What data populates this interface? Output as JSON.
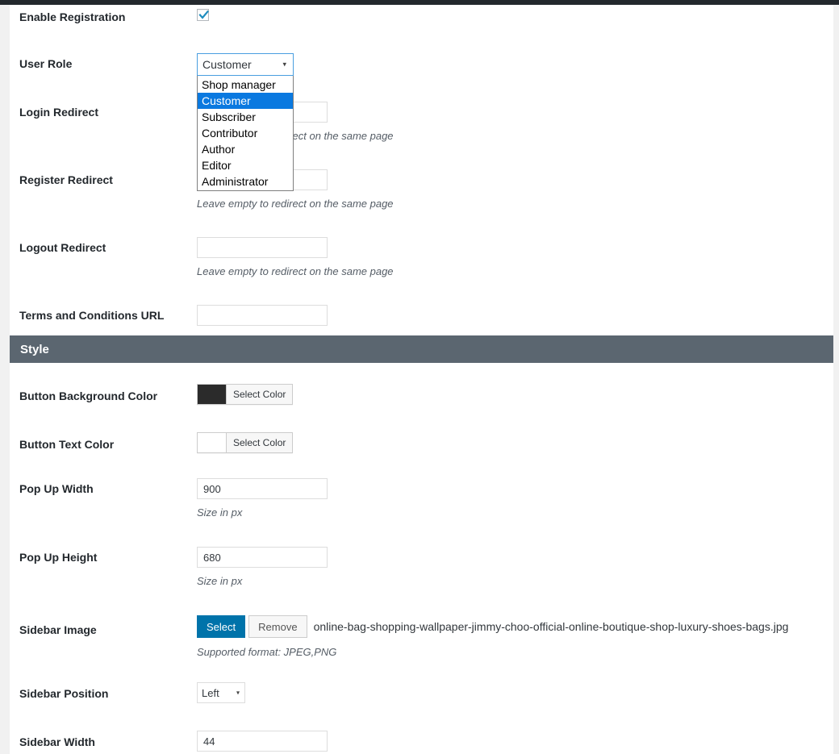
{
  "colors": {
    "adminbar": "#23282d",
    "section_header_bg": "#5b6670",
    "primary_button": "#0073aa",
    "select_highlight": "#0a79e0",
    "button_background_swatch": "#2b2b2b",
    "button_text_swatch": "#ffffff"
  },
  "fields": {
    "enable_registration": {
      "label": "Enable Registration",
      "checked": true
    },
    "user_role": {
      "label": "User Role",
      "value": "Customer",
      "expanded": true,
      "options": [
        "Shop manager",
        "Customer",
        "Subscriber",
        "Contributor",
        "Author",
        "Editor",
        "Administrator"
      ],
      "selected_index": 1
    },
    "login_redirect": {
      "label": "Login Redirect",
      "value": "",
      "hint": "Leave empty to redirect on the same page"
    },
    "register_redirect": {
      "label": "Register Redirect",
      "value": "",
      "hint": "Leave empty to redirect on the same page"
    },
    "logout_redirect": {
      "label": "Logout Redirect",
      "value": "",
      "hint": "Leave empty to redirect on the same page"
    },
    "terms_url": {
      "label": "Terms and Conditions URL",
      "value": ""
    },
    "button_background_color": {
      "label": "Button Background Color",
      "button_label": "Select Color",
      "swatch": "#2b2b2b"
    },
    "button_text_color": {
      "label": "Button Text Color",
      "button_label": "Select Color",
      "swatch": "#ffffff"
    },
    "popup_width": {
      "label": "Pop Up Width",
      "value": "900",
      "hint": "Size in px"
    },
    "popup_height": {
      "label": "Pop Up Height",
      "value": "680",
      "hint": "Size in px"
    },
    "sidebar_image": {
      "label": "Sidebar Image",
      "select_label": "Select",
      "remove_label": "Remove",
      "filename": "online-bag-shopping-wallpaper-jimmy-choo-official-online-boutique-shop-luxury-shoes-bags.jpg",
      "hint": "Supported format: JPEG,PNG"
    },
    "sidebar_position": {
      "label": "Sidebar Position",
      "value": "Left"
    },
    "sidebar_width": {
      "label": "Sidebar Width",
      "value": "44"
    }
  },
  "sections": {
    "style": {
      "title": "Style"
    }
  },
  "icons": {
    "caret": "▾"
  }
}
